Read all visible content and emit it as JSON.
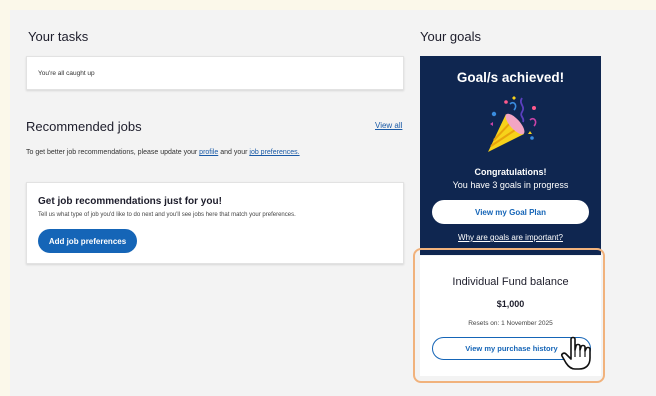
{
  "tasks": {
    "title": "Your tasks",
    "caught_up": "You're all caught up"
  },
  "jobs": {
    "title": "Recommended jobs",
    "view_all": "View all",
    "update_text_before": "To get better job recommendations, please update your ",
    "profile_link": "profile",
    "and_text": " and your ",
    "preferences_link": "job preferences.",
    "card_title": "Get job recommendations just for you!",
    "card_desc": "Tell us what type of job you'd like to do next and you'll see jobs here that match your preferences.",
    "add_button": "Add job preferences"
  },
  "goals": {
    "title": "Your goals",
    "achieved": "Goal/s achieved!",
    "congrats": "Congratulations!",
    "progress": "You have 3 goals in progress",
    "plan_button": "View my Goal Plan",
    "why_link": "Why are goals are important?"
  },
  "fund": {
    "title": "Individual Fund balance",
    "amount": "$1,000",
    "resets": "Resets on: 1 November 2025",
    "history_button": "View my purchase history"
  },
  "colors": {
    "primary_blue": "#1565b7",
    "goal_navy": "#0f2650",
    "highlight_orange": "#f1b27c"
  }
}
